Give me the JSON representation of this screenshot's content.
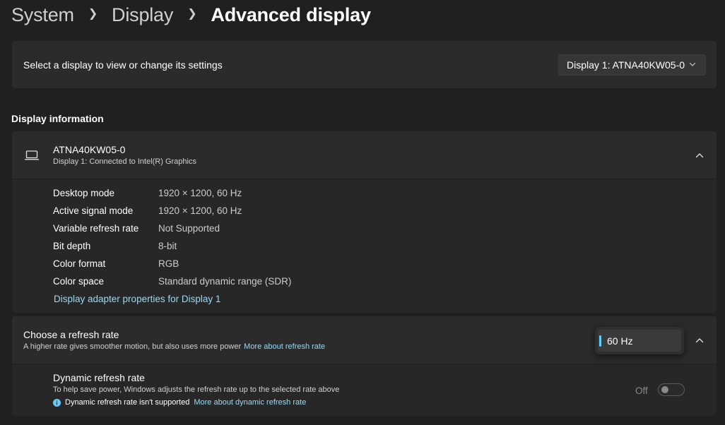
{
  "breadcrumb": {
    "items": [
      "System",
      "Display"
    ],
    "current": "Advanced display"
  },
  "select_display": {
    "label": "Select a display to view or change its settings",
    "selected": "Display 1: ATNA40KW05-0"
  },
  "display_information": {
    "section_title": "Display information",
    "monitor_name": "ATNA40KW05-0",
    "monitor_subtitle": "Display 1: Connected to Intel(R) Graphics",
    "rows": [
      {
        "label": "Desktop mode",
        "value": "1920 × 1200, 60 Hz"
      },
      {
        "label": "Active signal mode",
        "value": "1920 × 1200, 60 Hz"
      },
      {
        "label": "Variable refresh rate",
        "value": "Not Supported"
      },
      {
        "label": "Bit depth",
        "value": "8-bit"
      },
      {
        "label": "Color format",
        "value": "RGB"
      },
      {
        "label": "Color space",
        "value": "Standard dynamic range (SDR)"
      }
    ],
    "adapter_link": "Display adapter properties for Display 1"
  },
  "refresh_rate": {
    "title": "Choose a refresh rate",
    "subtitle": "A higher rate gives smoother motion, but also uses more power",
    "more_link": "More about refresh rate",
    "selected": "60 Hz"
  },
  "dynamic_refresh": {
    "title": "Dynamic refresh rate",
    "subtitle": "To help save power, Windows adjusts the refresh rate up to the selected rate above",
    "note": "Dynamic refresh rate isn't supported",
    "more_link": "More about dynamic refresh rate",
    "toggle_state": "Off"
  },
  "colors": {
    "background": "#202020",
    "card": "#2b2b2b",
    "accent": "#60cdff",
    "link": "#99d9f4"
  },
  "icons": [
    "chevron-right-icon",
    "chevron-down-icon",
    "chevron-up-icon",
    "laptop-icon",
    "info-icon"
  ]
}
